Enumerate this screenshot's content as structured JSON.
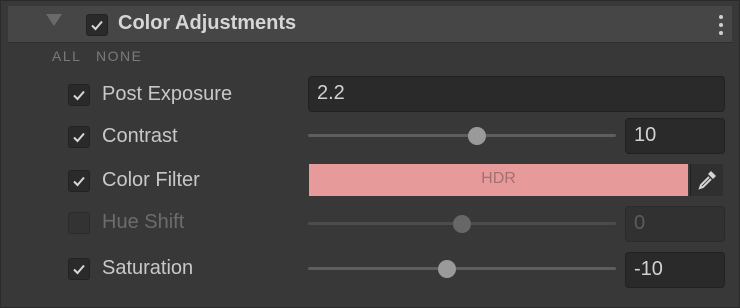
{
  "component": {
    "title": "Color Adjustments",
    "enabled": true,
    "expanded": true,
    "menu_icon": "kebab-menu-icon"
  },
  "toggles": {
    "all_label": "ALL",
    "none_label": "NONE"
  },
  "properties": [
    {
      "label": "Post Exposure",
      "enabled": true,
      "control": "float-field",
      "value": "2.2"
    },
    {
      "label": "Contrast",
      "enabled": true,
      "control": "slider",
      "value": "10",
      "slider_range": [
        -100,
        100
      ]
    },
    {
      "label": "Color Filter",
      "enabled": true,
      "control": "color-field",
      "badge": "HDR",
      "color": "#e79a9a",
      "picker_icon": "eyedropper-icon"
    },
    {
      "label": "Hue Shift",
      "enabled": false,
      "control": "slider",
      "value": "0",
      "slider_range": [
        -180,
        180
      ]
    },
    {
      "label": "Saturation",
      "enabled": true,
      "control": "slider",
      "value": "-10",
      "slider_range": [
        -100,
        100
      ]
    }
  ],
  "colors": {
    "background": "#383838",
    "header": "#464646",
    "field": "#2a2a2a",
    "swatch": "#e79a9a"
  }
}
